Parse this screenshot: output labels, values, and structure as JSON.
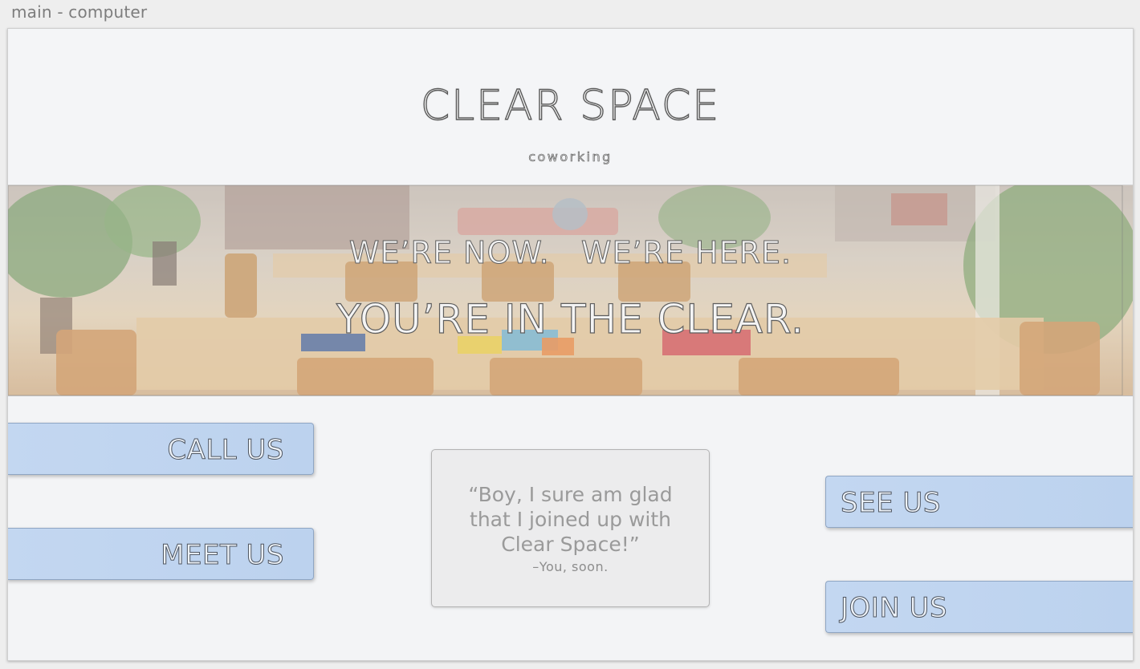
{
  "window": {
    "title": "main - computer"
  },
  "header": {
    "brand": "CLEAR SPACE",
    "tagline": "coworking"
  },
  "hero": {
    "line1": "WE’RE NOW.   WE’RE HERE.",
    "line2": "YOU’RE IN THE CLEAR."
  },
  "actions": {
    "call": "CALL US",
    "meet": "MEET US",
    "see": "SEE US",
    "join": "JOIN US"
  },
  "testimonial": {
    "quote": "“Boy, I sure am glad that I joined up with Clear Space!”",
    "author": "–You, soon."
  },
  "colors": {
    "button_fill": "#c3d7f1",
    "page_background": "#f3f4f6",
    "quote_card": "#ececed"
  }
}
